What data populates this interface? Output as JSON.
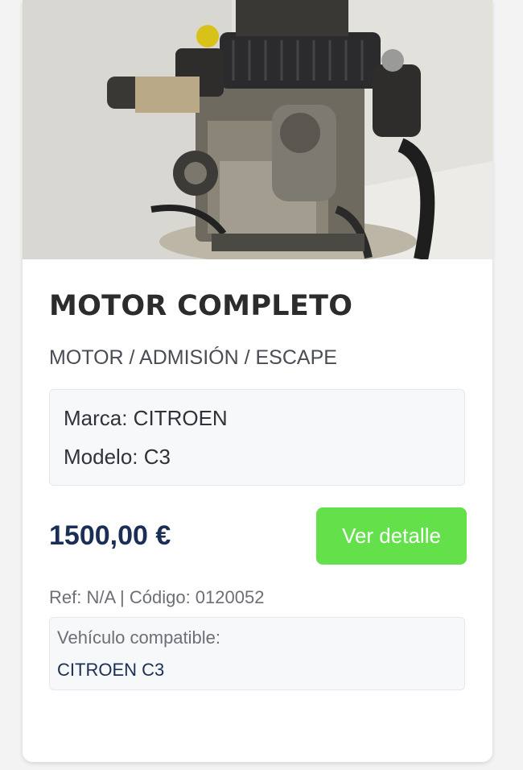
{
  "product": {
    "title": "MOTOR COMPLETO",
    "category": "MOTOR / ADMISIÓN / ESCAPE",
    "specs": {
      "brand_line": "Marca: CITROEN",
      "model_line": "Modelo: C3"
    },
    "price": "1500,00 €",
    "detail_button_label": "Ver detalle",
    "reference_line": "Ref: N/A | Código: 0120052",
    "compatibility": {
      "label": "Vehículo compatible:",
      "vehicle": "CITROEN C3"
    },
    "image_alt": "engine-photo"
  },
  "colors": {
    "button": "#64e04b",
    "price": "#1b2f55",
    "title": "#2c2c2c"
  }
}
